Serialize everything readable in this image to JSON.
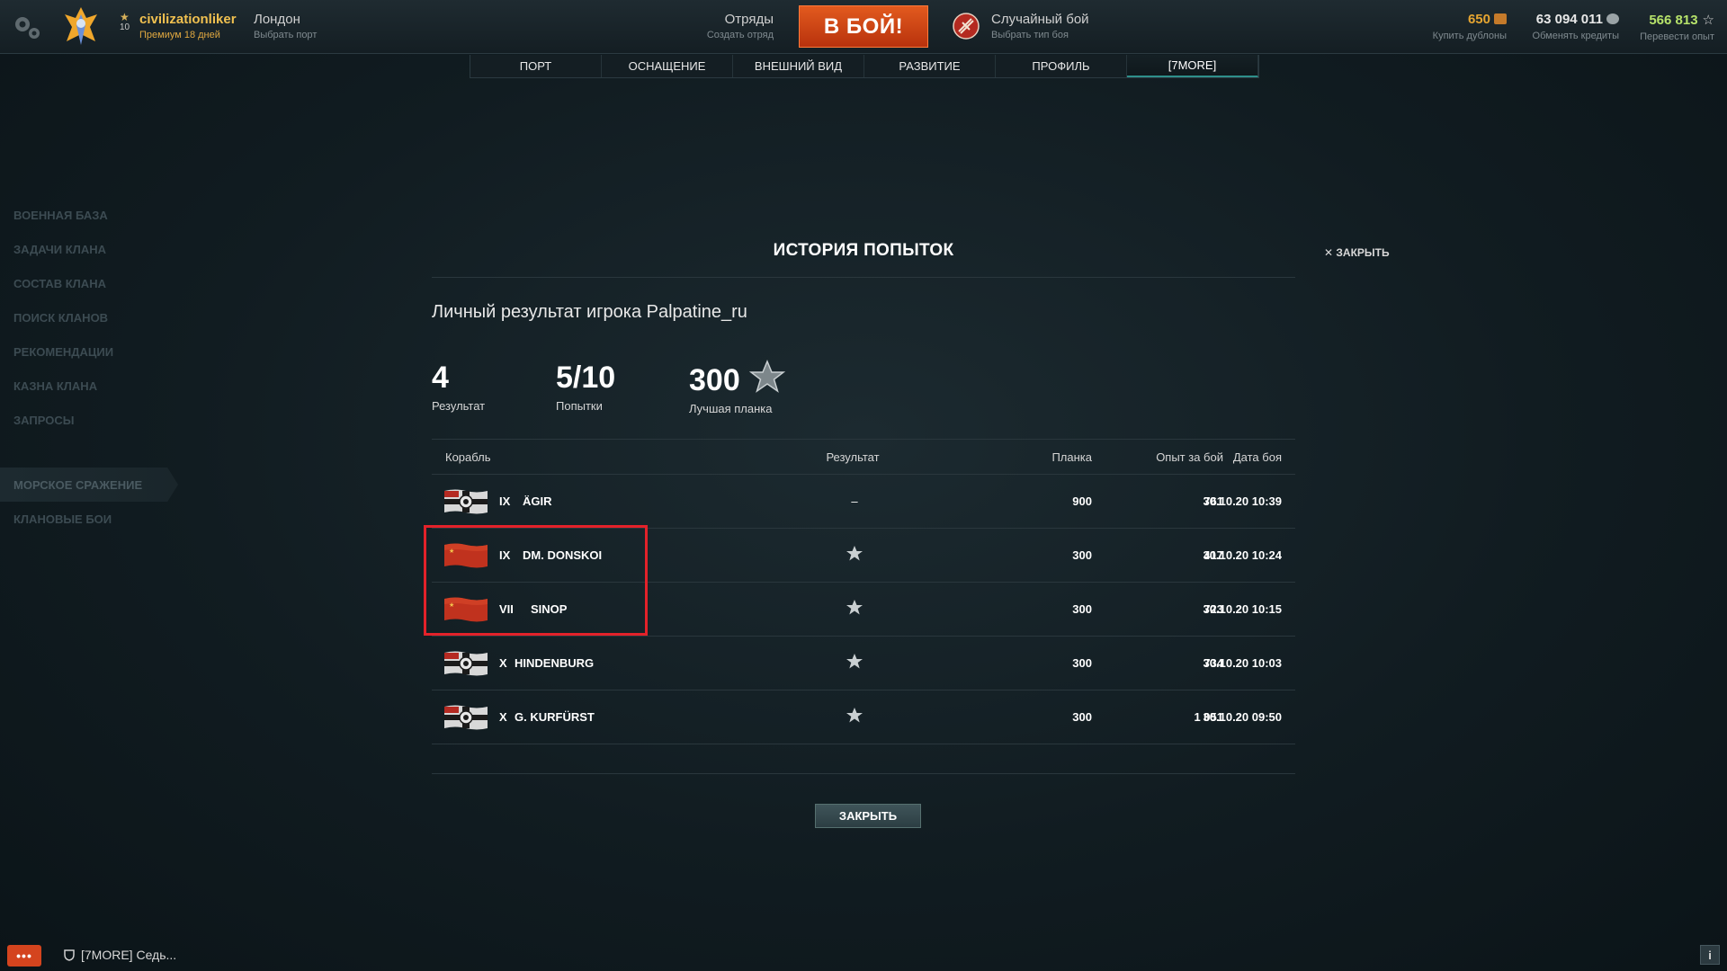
{
  "header": {
    "username": "civilizationliker",
    "premium": "Премиум 18 дней",
    "rank": "10",
    "port": {
      "name": "Лондон",
      "sub": "Выбрать порт"
    },
    "squad": {
      "title": "Отряды",
      "sub": "Создать отряд"
    },
    "battle_button": "В БОЙ!",
    "mode": {
      "title": "Случайный бой",
      "sub": "Выбрать тип боя"
    },
    "currencies": [
      {
        "value": "650",
        "label": "Купить дублоны",
        "color": "#e6a531",
        "icon": "doubloon-icon"
      },
      {
        "value": "63 094 011",
        "label": "Обменять кредиты",
        "color": "#e8e8e8",
        "icon": "credits-icon"
      },
      {
        "value": "566 813",
        "label": "Перевести опыт",
        "color": "#b6e26a",
        "icon": "free-xp-icon"
      }
    ]
  },
  "tabs": [
    "ПОРТ",
    "ОСНАЩЕНИЕ",
    "ВНЕШНИЙ ВИД",
    "РАЗВИТИЕ",
    "ПРОФИЛЬ",
    "[7MORE]"
  ],
  "active_tab": "[7MORE]",
  "sidebar": {
    "items": [
      "ВОЕННАЯ БАЗА",
      "ЗАДАЧИ КЛАНА",
      "СОСТАВ КЛАНА",
      "ПОИСК КЛАНОВ",
      "РЕКОМЕНДАЦИИ",
      "КАЗНА КЛАНА",
      "ЗАПРОСЫ"
    ],
    "items2": [
      "МОРСКОЕ СРАЖЕНИЕ",
      "КЛАНОВЫЕ БОИ"
    ],
    "active": "МОРСКОЕ СРАЖЕНИЕ"
  },
  "modal": {
    "title": "ИСТОРИЯ ПОПЫТОК",
    "close_x": "ЗАКРЫТЬ",
    "player_result": "Личный результат игрока Palpatine_ru",
    "stats": [
      {
        "value": "4",
        "label": "Результат"
      },
      {
        "value": "5/10",
        "label": "Попытки"
      },
      {
        "value": "300",
        "label": "Лучшая планка"
      }
    ],
    "columns": {
      "ship": "Корабль",
      "result": "Результат",
      "plank": "Планка",
      "xp": "Опыт за бой",
      "date": "Дата боя"
    },
    "rows": [
      {
        "nation": "germany",
        "tier": "IX",
        "ship": "ÄGIR",
        "result": "–",
        "plank": "900",
        "xp": "761",
        "date": "30.10.20 10:39"
      },
      {
        "nation": "ussr",
        "tier": "IX",
        "ship": "DM. DONSKOI",
        "result": "star",
        "plank": "300",
        "xp": "417",
        "date": "30.10.20 10:24"
      },
      {
        "nation": "ussr",
        "tier": "VII",
        "ship": "SINOP",
        "result": "star",
        "plank": "300",
        "xp": "723",
        "date": "30.10.20 10:15"
      },
      {
        "nation": "germany",
        "tier": "X",
        "ship": "HINDENBURG",
        "result": "star",
        "plank": "300",
        "xp": "734",
        "date": "30.10.20 10:03"
      },
      {
        "nation": "germany",
        "tier": "X",
        "ship": "G. KURFÜRST",
        "result": "star",
        "plank": "300",
        "xp": "1 051",
        "date": "30.10.20 09:50"
      }
    ],
    "close_button": "ЗАКРЫТЬ"
  },
  "chat": {
    "clan_text": "[7MORE] Седь..."
  },
  "info_button": "i",
  "chat_button": "•••"
}
